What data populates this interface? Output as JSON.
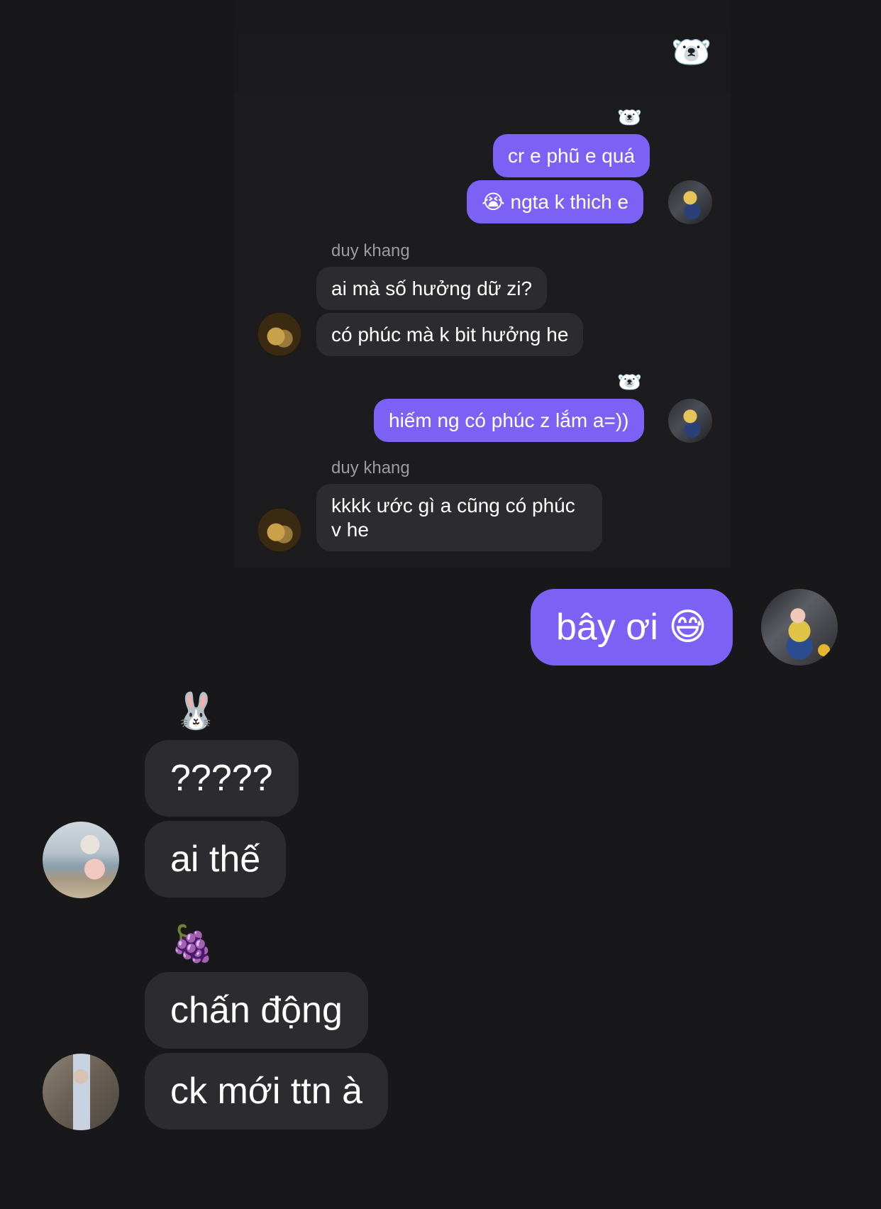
{
  "chat": {
    "inner_header_emoji": "🐻‍❄️",
    "inner_messages": [
      {
        "reaction_emoji": "🐻‍❄️"
      },
      {
        "text": "cr e phũ e quá"
      },
      {
        "text": "😭 ngta k thich e"
      },
      {
        "sender": "duy khang"
      },
      {
        "text": "ai mà số hưởng dữ zi?"
      },
      {
        "text": "có phúc mà k bit hưởng he"
      },
      {
        "reaction_emoji": "🐻‍❄️"
      },
      {
        "text": "hiếm ng có phúc z lắm a=))"
      },
      {
        "sender": "duy khang"
      },
      {
        "text": "kkkk ước gì a cũng có phúc v he"
      }
    ],
    "outgoing": {
      "text": "bây ơi 😅"
    },
    "group1": {
      "emoji": "🐰",
      "messages": [
        "?????",
        "ai thế"
      ]
    },
    "group2": {
      "emoji": "🍇",
      "messages": [
        "chấn động",
        "ck mới ttn à"
      ]
    }
  }
}
